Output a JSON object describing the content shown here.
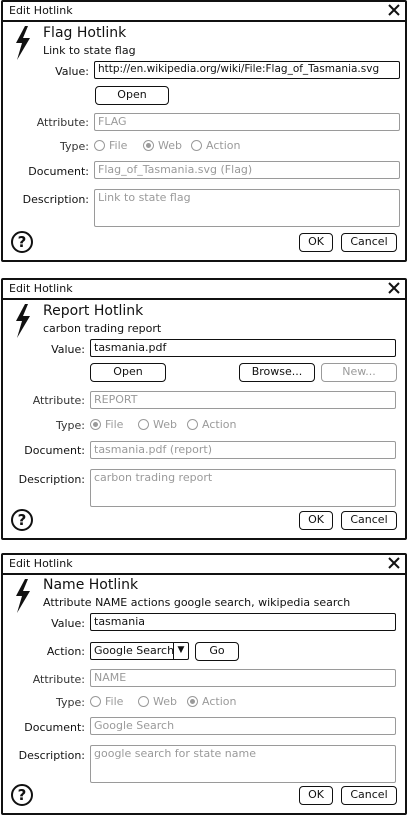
{
  "dialogs": [
    {
      "title": "Edit Hotlink",
      "heading": "Flag Hotlink",
      "subheading": "Link to state flag",
      "value_label": "Value:",
      "value": "http://en.wikipedia.org/wiki/File:Flag_of_Tasmania.svg",
      "open_label": "Open",
      "attribute_label": "Attribute:",
      "attribute": "FLAG",
      "type_label": "Type:",
      "type_options": [
        "File",
        "Web",
        "Action"
      ],
      "type_selected": "Web",
      "document_label": "Document:",
      "document": "Flag_of_Tasmania.svg (Flag)",
      "description_label": "Description:",
      "description": "Link to state flag",
      "help_label": "?",
      "ok_label": "OK",
      "cancel_label": "Cancel"
    },
    {
      "title": "Edit Hotlink",
      "heading": "Report Hotlink",
      "subheading": "carbon trading report",
      "value_label": "Value:",
      "value": "tasmania.pdf",
      "open_label": "Open",
      "browse_label": "Browse...",
      "new_label": "New...",
      "attribute_label": "Attribute:",
      "attribute": "REPORT",
      "type_label": "Type:",
      "type_options": [
        "File",
        "Web",
        "Action"
      ],
      "type_selected": "File",
      "document_label": "Document:",
      "document": "tasmania.pdf (report)",
      "description_label": "Description:",
      "description": "carbon trading report",
      "help_label": "?",
      "ok_label": "OK",
      "cancel_label": "Cancel"
    },
    {
      "title": "Edit Hotlink",
      "heading": "Name Hotlink",
      "subheading": "Attribute NAME actions google search, wikipedia search",
      "value_label": "Value:",
      "value": "tasmania",
      "action_label": "Action:",
      "action_selected": "Google Search",
      "go_label": "Go",
      "attribute_label": "Attribute:",
      "attribute": "NAME",
      "type_label": "Type:",
      "type_options": [
        "File",
        "Web",
        "Action"
      ],
      "type_selected": "Action",
      "document_label": "Document:",
      "document": "Google Search",
      "description_label": "Description:",
      "description": "google search for state name",
      "help_label": "?",
      "ok_label": "OK",
      "cancel_label": "Cancel"
    }
  ],
  "icons": {
    "bolt": "lightning-bolt-icon",
    "close": "close-icon",
    "help": "help-icon",
    "dropdown": "dropdown-arrow-icon"
  }
}
